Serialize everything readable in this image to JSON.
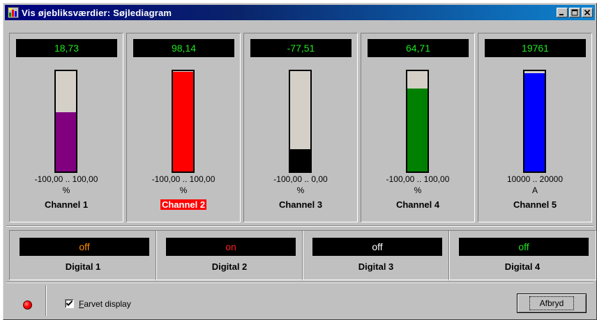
{
  "window": {
    "title": "Vis øjebliksværdier: Søjlediagram",
    "controls": [
      "minimize",
      "maximize",
      "close"
    ]
  },
  "channels": [
    {
      "value": "18,73",
      "range": "-100,00 .. 100,00",
      "unit": "%",
      "name": "Channel 1",
      "level": 0.5937,
      "color": "#800080",
      "highlighted": false
    },
    {
      "value": "98,14",
      "range": "-100,00 .. 100,00",
      "unit": "%",
      "name": "Channel 2",
      "level": 0.9907,
      "color": "#ff0000",
      "highlighted": true
    },
    {
      "value": "-77,51",
      "range": "-100,00 .. 0,00",
      "unit": "%",
      "name": "Channel 3",
      "level": 0.2249,
      "color": "#000000",
      "highlighted": false
    },
    {
      "value": "64,71",
      "range": "-100,00 .. 100,00",
      "unit": "%",
      "name": "Channel 4",
      "level": 0.8236,
      "color": "#008000",
      "highlighted": false
    },
    {
      "value": "19761",
      "range": "10000 .. 20000",
      "unit": "A",
      "name": "Channel 5",
      "level": 0.9761,
      "color": "#0000ff",
      "highlighted": false
    }
  ],
  "digitals": [
    {
      "state": "off",
      "name": "Digital 1",
      "color": "#ff8c00"
    },
    {
      "state": "on",
      "name": "Digital 2",
      "color": "#ff2020"
    },
    {
      "state": "off",
      "name": "Digital 3",
      "color": "#ffffff"
    },
    {
      "state": "off",
      "name": "Digital 4",
      "color": "#1ee81e"
    }
  ],
  "bottom": {
    "status_led_color": "#ff0000",
    "checkbox_checked": true,
    "checkbox_label_accel": "F",
    "checkbox_label_rest": "arvet display",
    "abort_label": "Afbryd"
  },
  "lcd_color": "#1ee81e"
}
